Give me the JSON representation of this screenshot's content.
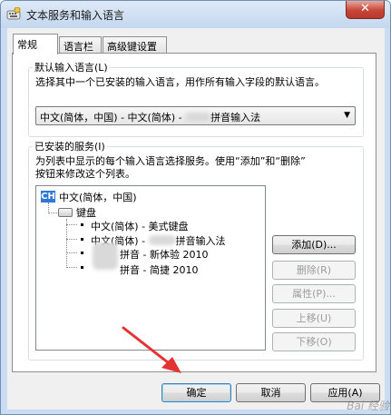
{
  "window": {
    "title": "文本服务和输入语言",
    "close_label": "✕"
  },
  "tabs": [
    {
      "label": "常规",
      "active": true
    },
    {
      "label": "语言栏",
      "active": false
    },
    {
      "label": "高级键设置",
      "active": false
    }
  ],
  "default_language": {
    "legend": "默认输入语言(L)",
    "description": "选择其中一个已安装的输入语言，用作所有输入字段的默认语言。",
    "selected_value": "中文(简体，中国) - 中文(简体) - ",
    "selected_value_suffix": "拼音输入法"
  },
  "installed_services": {
    "legend": "已安装的服务(I)",
    "description_line1": "为列表中显示的每个输入语言选择服务。使用“添加”和“删除”",
    "description_line2": "按钮来修改这个列表。",
    "language_badge": "CH",
    "language_name": "中文(简体，中国)",
    "category": "键盘",
    "items": [
      {
        "prefix": "中文(简体) - 美式键盘",
        "suffix": ""
      },
      {
        "prefix": "中文(简体) - ",
        "suffix": "拼音输入法"
      },
      {
        "prefix": "",
        "suffix": "拼音 - 新体验 2010"
      },
      {
        "prefix": "",
        "suffix": "拼音 - 简捷 2010"
      }
    ]
  },
  "side_buttons": {
    "add": "添加(D)...",
    "remove": "删除(R)",
    "properties": "属性(P)...",
    "move_up": "上移(U)",
    "move_down": "下移(O)"
  },
  "footer_buttons": {
    "ok": "确定",
    "cancel": "取消",
    "apply": "应用(A)"
  },
  "colors": {
    "accent": "#3078d8",
    "arrow": "#e53333",
    "title_bg": "#c9dcf1"
  }
}
